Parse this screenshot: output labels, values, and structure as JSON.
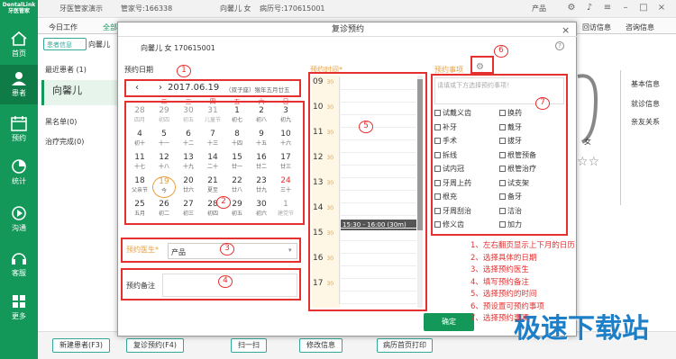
{
  "app": {
    "logo": "DentalLink\n牙医管家",
    "demo": "牙医管家演示",
    "acct": "管家号:166338",
    "patient_header": "向馨儿 女",
    "record": "病历号:170615001",
    "product": "产品"
  },
  "nav": [
    {
      "label": "首页"
    },
    {
      "label": "患者"
    },
    {
      "label": "预约"
    },
    {
      "label": "统计"
    },
    {
      "label": "沟通"
    },
    {
      "label": "客服"
    },
    {
      "label": "更多"
    }
  ],
  "tabs": {
    "today": "今日工作",
    "all": "全部",
    "visit": "回访信息",
    "consult": "咨询信息"
  },
  "list": {
    "filter": "患者信息",
    "recent": "最近患者 (1)",
    "patient": "向馨儿",
    "blacklist": "黑名单(0)",
    "done": "治疗完成(0)"
  },
  "right": {
    "basic": "基本信息",
    "visit": "就诊信息",
    "family": "亲友关系",
    "gender": "女"
  },
  "bottom": {
    "new": "新建患者(F3)",
    "revisit": "复诊预约(F4)",
    "scan": "扫一扫",
    "edit": "修改信息",
    "print": "病历首页打印"
  },
  "dialog": {
    "title": "复诊预约",
    "patient": "向馨儿  女  170615001",
    "date_label": "预约日期",
    "time_label": "预约时间*",
    "item_label": "预约事项",
    "item_placeholder": "请填或下方选择预约事项！",
    "doctor_label": "预约医生*",
    "doctor_value": "产品",
    "remark_label": "预约备注",
    "ok": "确定",
    "selected_time": "15:30 - 16:00 (30m)"
  },
  "calendar": {
    "title": "2017.06.19",
    "lunar": "（双子座）猴年五月廿五",
    "weekdays": [
      "一",
      "二",
      "三",
      "四",
      "五",
      "六",
      "日"
    ],
    "cells": [
      [
        "28",
        "四月"
      ],
      [
        "29",
        "初四"
      ],
      [
        "30",
        "初五"
      ],
      [
        "31",
        "儿童节"
      ],
      [
        "1",
        "初七"
      ],
      [
        "2",
        "初八"
      ],
      [
        "3",
        "初九"
      ],
      [
        "4",
        "初十"
      ],
      [
        "5",
        "十一"
      ],
      [
        "6",
        "十二"
      ],
      [
        "7",
        "十三"
      ],
      [
        "8",
        "十四"
      ],
      [
        "9",
        "十五"
      ],
      [
        "10",
        "十六"
      ],
      [
        "11",
        "十七"
      ],
      [
        "12",
        "十八"
      ],
      [
        "13",
        "十九"
      ],
      [
        "14",
        "二十"
      ],
      [
        "15",
        "廿一"
      ],
      [
        "16",
        "廿二"
      ],
      [
        "17",
        "廿三"
      ],
      [
        "18",
        "父亲节"
      ],
      [
        "19",
        "今"
      ],
      [
        "20",
        "廿六"
      ],
      [
        "21",
        "夏至"
      ],
      [
        "22",
        "廿八"
      ],
      [
        "23",
        "廿九"
      ],
      [
        "24",
        "三十"
      ],
      [
        "25",
        "五月"
      ],
      [
        "26",
        "初二"
      ],
      [
        "27",
        "初三"
      ],
      [
        "28",
        "初四"
      ],
      [
        "29",
        "初五"
      ],
      [
        "30",
        "初六"
      ],
      [
        "1",
        "建党节"
      ]
    ]
  },
  "times": [
    {
      "h": "09",
      "m": "30"
    },
    {
      "h": "10",
      "m": "30"
    },
    {
      "h": "11",
      "m": "30"
    },
    {
      "h": "12",
      "m": "30"
    },
    {
      "h": "13",
      "m": "30"
    },
    {
      "h": "14",
      "m": "30"
    },
    {
      "h": "15",
      "m": "30"
    },
    {
      "h": "16",
      "m": "30"
    },
    {
      "h": "17",
      "m": "30"
    }
  ],
  "items": [
    "试戴义齿",
    "换药",
    "补牙",
    "戴牙",
    "手术",
    "拔牙",
    "拆线",
    "根管预备",
    "试内冠",
    "根管治疗",
    "牙周上药",
    "试支架",
    "根充",
    "备牙",
    "牙周刮治",
    "洁治",
    "修义齿",
    "加力"
  ],
  "markers": [
    "1",
    "2",
    "3",
    "4",
    "5",
    "6",
    "7"
  ],
  "notes": [
    "1、左右翻页显示上下月的日历",
    "2、选择具体的日期",
    "3、选择预约医生",
    "4、填写预约备注",
    "5、选择预约的时间",
    "6、预设置可预约事项",
    "7、选择预约事项"
  ],
  "watermark": "极速下载站"
}
